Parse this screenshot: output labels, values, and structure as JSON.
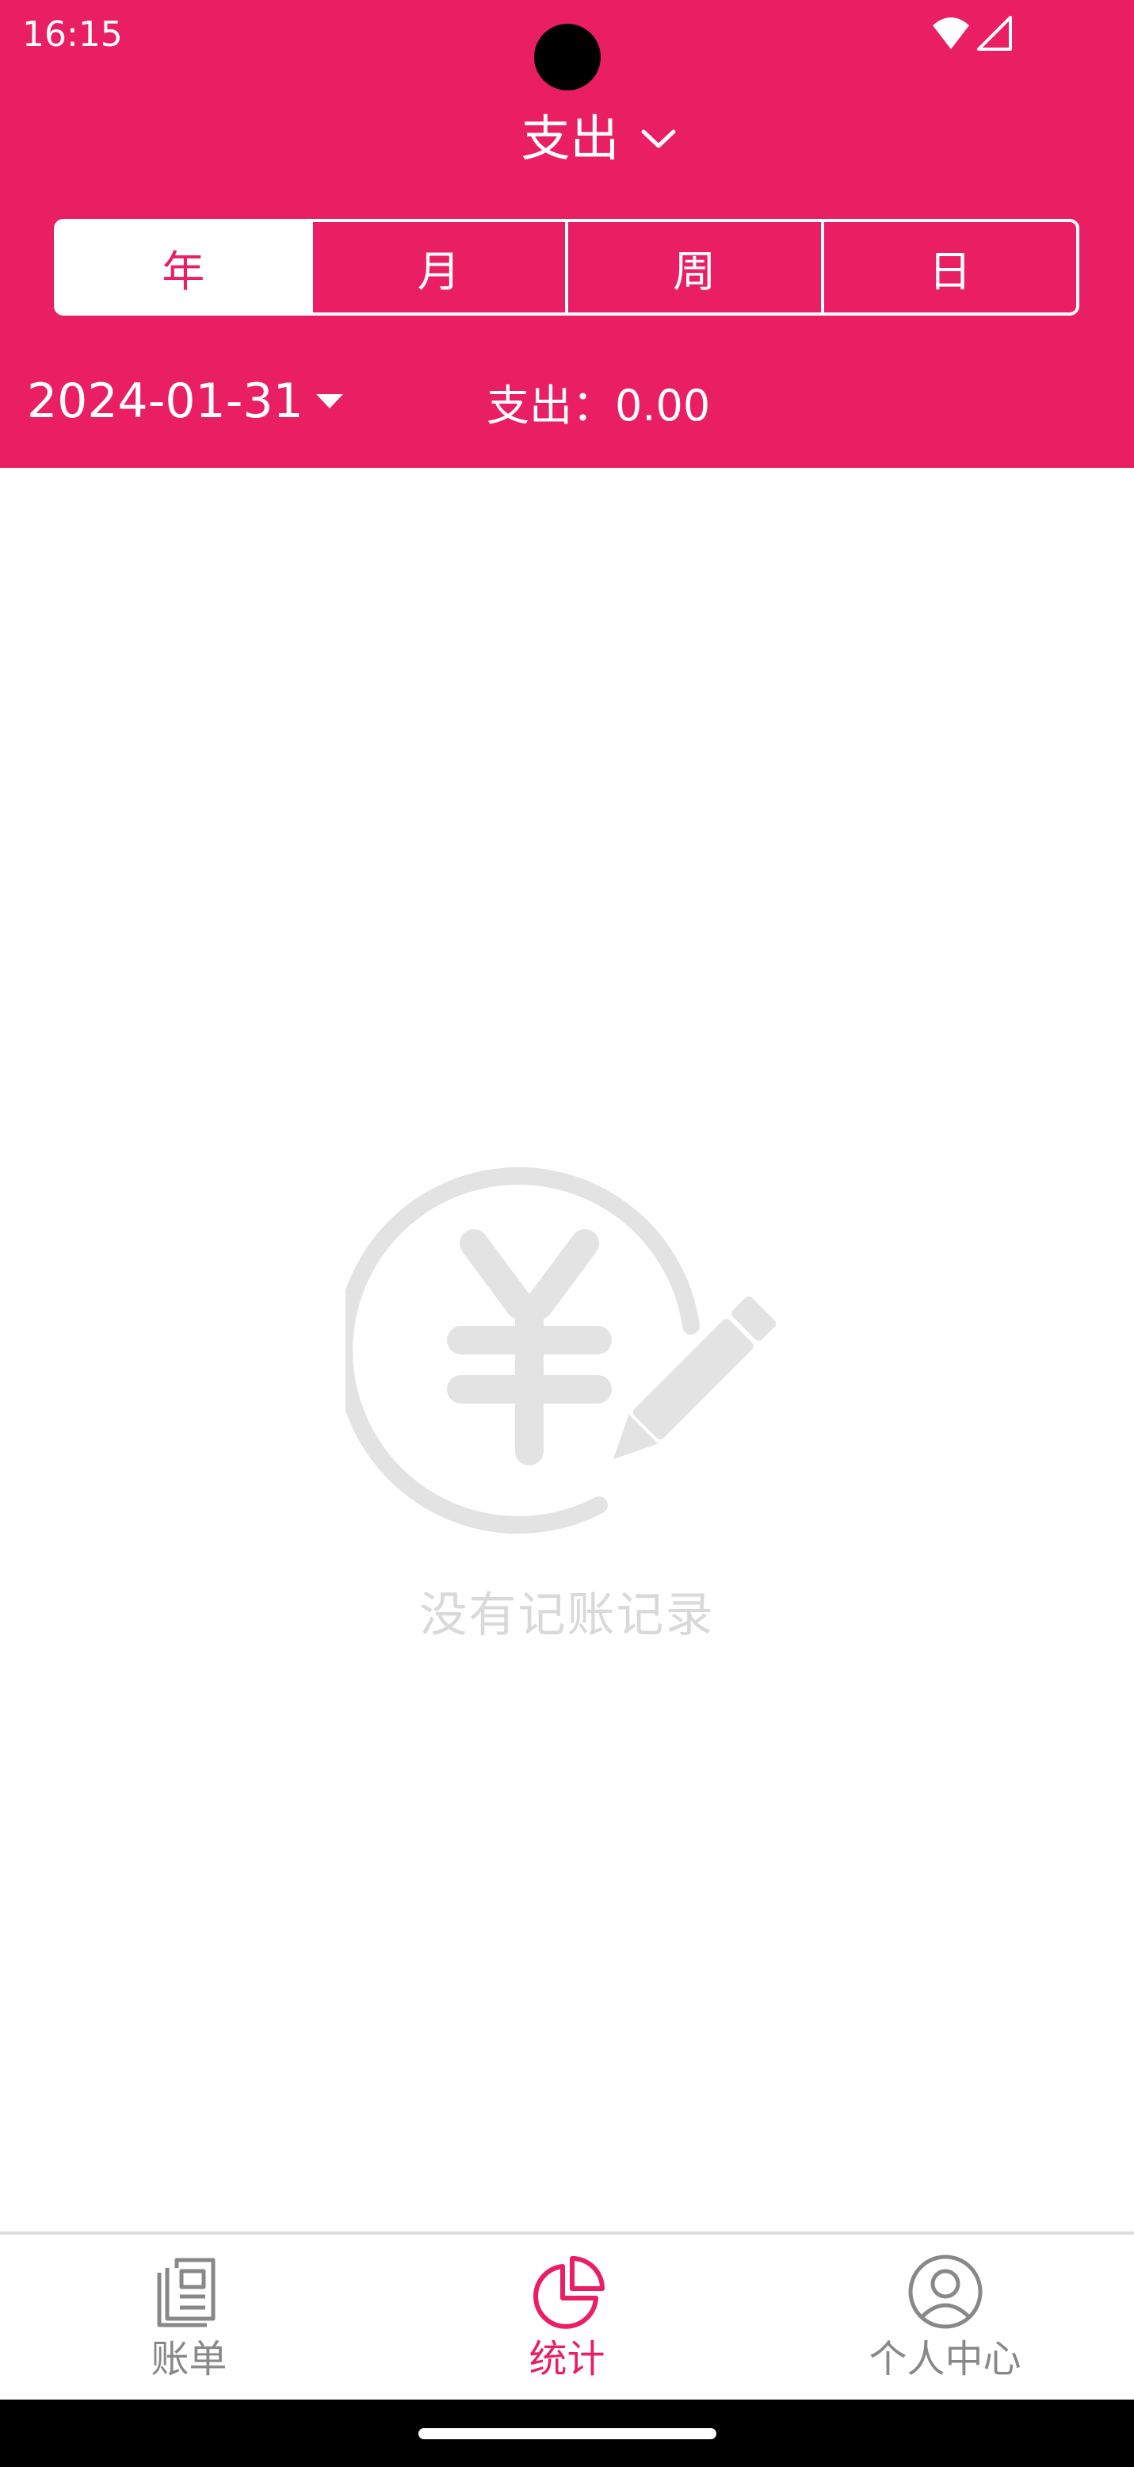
{
  "status_bar": {
    "time": "16:15",
    "icons": [
      "wifi-icon",
      "cellular-signal-icon"
    ]
  },
  "header": {
    "title": "支出",
    "title_icon": "chevron-down-icon",
    "segments": [
      {
        "label": "年",
        "active": true
      },
      {
        "label": "月",
        "active": false
      },
      {
        "label": "周",
        "active": false
      },
      {
        "label": "日",
        "active": false
      }
    ],
    "date": "2024-01-31",
    "date_icon": "caret-down-icon",
    "summary": "支出：0.00"
  },
  "empty_state": {
    "icon": "yuan-edit-icon",
    "text": "没有记账记录"
  },
  "bottom_nav": {
    "items": [
      {
        "label": "账单",
        "icon": "bill-list-icon",
        "active": false
      },
      {
        "label": "统计",
        "icon": "pie-chart-icon",
        "active": true
      },
      {
        "label": "个人中心",
        "icon": "user-profile-icon",
        "active": false
      }
    ]
  },
  "colors": {
    "primary": "#E91E63",
    "inactive": "#888888",
    "empty": "#D9D9D9"
  }
}
